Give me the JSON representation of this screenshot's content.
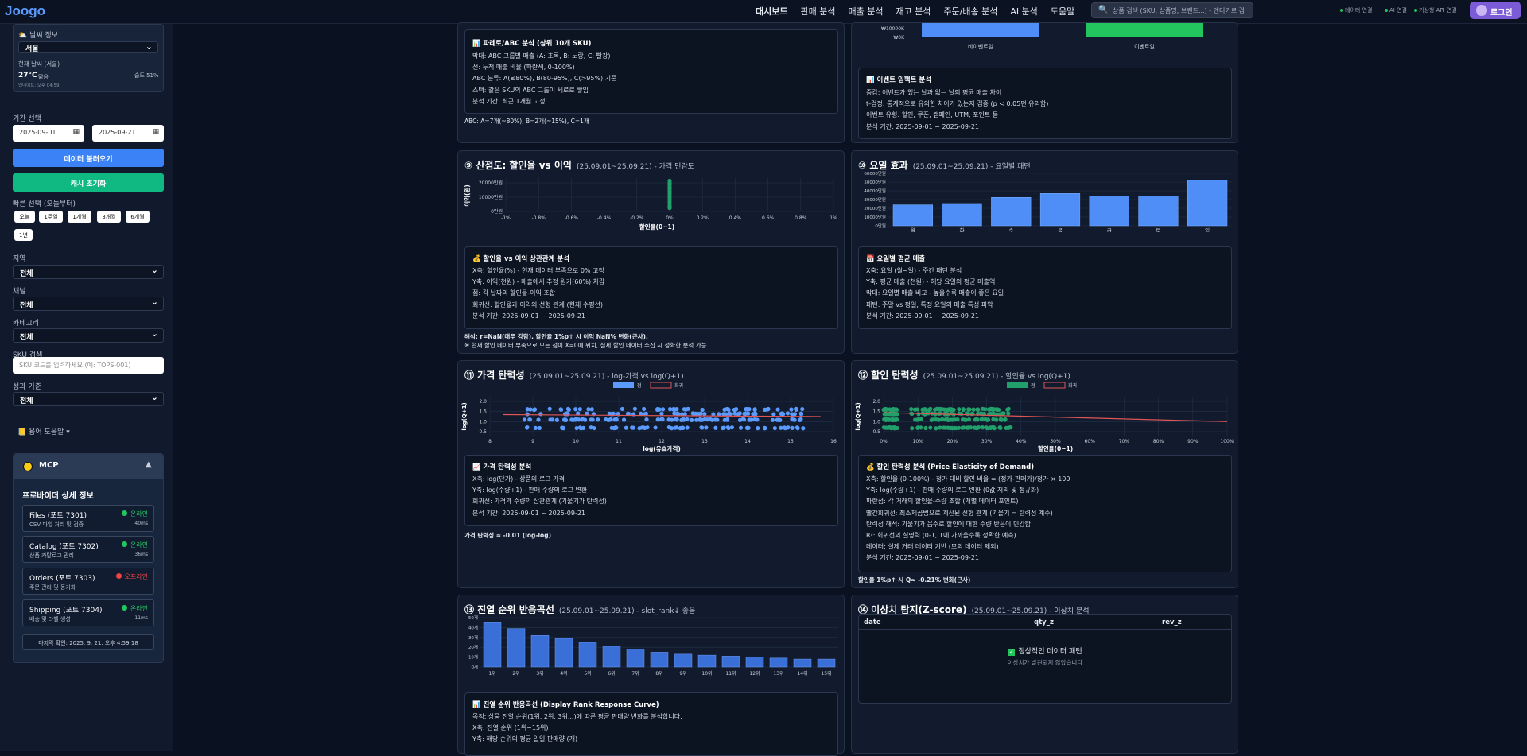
{
  "app": {
    "logo": "Joogo"
  },
  "nav": [
    "대시보드",
    "판매 분석",
    "매출 분석",
    "재고 분석",
    "주문/배송 분석",
    "AI 분석",
    "도움말"
  ],
  "search": {
    "placeholder": "상품 검색 (SKU, 상품명, 브랜드...) - 엔터키로 검"
  },
  "status": [
    "데이터 연결",
    "AI 연결",
    "기상청 API 연결"
  ],
  "login": "로그인",
  "sidebar": {
    "weather": {
      "title": "날씨 정보",
      "city": "서울",
      "current_label": "현재 날씨 (서울)",
      "temp": "27°C",
      "condition": "맑음",
      "humidity": "습도 51%",
      "updated": "업데이트: 오후 04:59"
    },
    "period_label": "기간 선택",
    "date_from": "2025-09-01",
    "date_to": "2025-09-21",
    "load_btn": "데이터 불러오기",
    "cache_btn": "캐시 초기화",
    "quick_label": "빠른 선택 (오늘부터)",
    "quick": [
      "오늘",
      "1주일",
      "1개월",
      "3개월",
      "6개월",
      "1년"
    ],
    "region_label": "지역",
    "region_value": "전체",
    "channel_label": "채널",
    "channel_value": "전체",
    "category_label": "카테고리",
    "category_value": "전체",
    "sku_label": "SKU 검색",
    "sku_placeholder": "SKU 코드를 입력하세요 (예: TOPS-001)",
    "perf_label": "성과 기준",
    "perf_value": "전체",
    "glossary": "용어 도움말",
    "mcp": {
      "title": "MCP",
      "subtitle": "프로바이더 상세 정보",
      "providers": [
        {
          "name": "Files (포트 7301)",
          "desc": "CSV 파일 처리 및 검증",
          "status": "온라인",
          "ms": "40ms",
          "color": "#22c55e"
        },
        {
          "name": "Catalog (포트 7302)",
          "desc": "상품 카탈로그 관리",
          "status": "온라인",
          "ms": "36ms",
          "color": "#22c55e"
        },
        {
          "name": "Orders (포트 7303)",
          "desc": "주문 관리 및 동기화",
          "status": "오프라인",
          "ms": "",
          "color": "#ef4444"
        },
        {
          "name": "Shipping (포트 7304)",
          "desc": "배송 및 라벨 생성",
          "status": "온라인",
          "ms": "11ms",
          "color": "#22c55e"
        }
      ],
      "last_check": "마지막 확인: 2025. 9. 21. 오후 4:59:18"
    }
  },
  "pareto_info": {
    "title": "파레토/ABC 분석 (상위 10개 SKU)",
    "items": [
      "막대: ABC 그룹별 매출 (A: 초록, B: 노랑, C: 빨강)",
      "선: 누적 매출 비율 (파란색, 0-100%)",
      "ABC 분류: A(≤80%), B(80-95%), C(>95%) 기준",
      "스택: 같은 SKU의 ABC 그룹이 세로로 쌓임",
      "분석 기간: 최근 1개월 고정"
    ],
    "summary": "ABC: A=7개(≈80%), B=2개(≈15%), C=1개"
  },
  "event_chart": {
    "y_label": "₩10000K",
    "y_zero": "₩0K",
    "categories": [
      "비이벤트일",
      "이벤트일"
    ]
  },
  "event_info": {
    "title": "이벤트 임팩트 분석",
    "items": [
      "증감: 이벤트가 있는 날과 없는 날의 평균 매출 차이",
      "t-검정: 통계적으로 유의한 차이가 있는지 검증 (p < 0.05면 유의함)",
      "이벤트 유형: 할인, 쿠폰, 캠페인, UTM, 포인트 등",
      "분석 기간: 2025-09-01 ~ 2025-09-21"
    ]
  },
  "scatter": {
    "title": "⑨ 산점도: 할인율 vs 이익",
    "subtitle": "(25.09.01~25.09.21) - 가격 민감도",
    "chart_data": {
      "type": "scatter",
      "ylabel": "이익(원)",
      "xlabel": "할인율(0~1)",
      "yticks": [
        "20000만원",
        "10000만원",
        "0만원"
      ],
      "xticks": [
        "-1%",
        "-0.8%",
        "-0.6%",
        "-0.4%",
        "-0.2%",
        "0%",
        "0.2%",
        "0.4%",
        "0.6%",
        "0.8%",
        "1%"
      ],
      "x": [
        0,
        0,
        0,
        0,
        0,
        0,
        0,
        0,
        0,
        0,
        0,
        0,
        0,
        0
      ],
      "y": [
        22000,
        20500,
        19000,
        17500,
        16000,
        14500,
        13000,
        11500,
        10000,
        8500,
        7000,
        5500,
        4000,
        2500
      ]
    },
    "info_title": "할인율 vs 이익 상관관계 분석",
    "items": [
      "X축: 할인율(%) - 현재 데이터 부족으로 0% 고정",
      "Y축: 이익(천원) - 매출에서 추정 원가(60%) 차감",
      "점: 각 날짜의 할인율-이익 조합",
      "회귀선: 할인율과 이익의 선형 관계 (현재 수평선)",
      "분석 기간: 2025-09-01 ~ 2025-09-21"
    ],
    "note1": "해석: r=NaN(매우 강함). 할인율 1%p↑ 시 이익 NaN% 변화(근사).",
    "note2": "※ 현재 할인 데이터 부족으로 모든 점이 X=0에 위치, 실제 할인 데이터 수집 시 정확한 분석 가능"
  },
  "weekday": {
    "title": "⑩ 요일 효과",
    "subtitle": "(25.09.01~25.09.21) - 요일별 패턴",
    "chart_data": {
      "type": "bar",
      "categories": [
        "월",
        "화",
        "수",
        "목",
        "금",
        "토",
        "일"
      ],
      "values": [
        24000000,
        25500000,
        32500000,
        37000000,
        34000000,
        34000000,
        52000000
      ],
      "yticks": [
        "60000만원",
        "50000만원",
        "40000만원",
        "30000만원",
        "20000만원",
        "10000만원",
        "0만원"
      ],
      "ylim": [
        0,
        60000000
      ]
    },
    "info_title": "요일별 평균 매출",
    "items": [
      "X축: 요일 (월~일) - 주간 패턴 분석",
      "Y축: 평균 매출 (천원) - 해당 요일의 평균 매출액",
      "막대: 요일별 매출 비교 - 높을수록 매출이 좋은 요일",
      "패턴: 주말 vs 평일, 특정 요일의 매출 특성 파악",
      "분석 기간: 2025-09-01 ~ 2025-09-21"
    ]
  },
  "price_el": {
    "title": "⑪ 가격 탄력성",
    "subtitle": "(25.09.01~25.09.21) - log-가격 vs log(Q+1)",
    "chart_data": {
      "type": "scatter",
      "legend": [
        "점",
        "회귀"
      ],
      "ylabel": "log(Q+1)",
      "xlabel": "log(유효가격)",
      "xticks": [
        "8",
        "9",
        "10",
        "11",
        "12",
        "13",
        "14",
        "15",
        "16"
      ],
      "yticks": [
        "2.0",
        "1.5",
        "1.0",
        "0.5"
      ],
      "xlim": [
        8,
        16
      ],
      "ylim": [
        0.3,
        2.2
      ],
      "reg": [
        [
          8.3,
          1.35
        ],
        [
          15.7,
          1.25
        ]
      ]
    },
    "info_title": "가격 탄력성 분석",
    "items": [
      "X축: log(단가) - 상품의 로그 가격",
      "Y축: log(수량+1) - 판매 수량의 로그 변환",
      "회귀선: 가격과 수량의 상관관계 (기울기가 탄력성)",
      "분석 기간: 2025-09-01 ~ 2025-09-21"
    ],
    "note": "가격 탄력성 ≈ -0.01 (log-log)"
  },
  "disc_el": {
    "title": "⑫ 할인 탄력성",
    "subtitle": "(25.09.01~25.09.21) - 할인율 vs log(Q+1)",
    "chart_data": {
      "type": "scatter",
      "legend": [
        "점",
        "회귀"
      ],
      "ylabel": "log(Q+1)",
      "xlabel": "할인율(0~1)",
      "xticks": [
        "0%",
        "10%",
        "20%",
        "30%",
        "40%",
        "50%",
        "60%",
        "70%",
        "80%",
        "90%",
        "100%"
      ],
      "yticks": [
        "2.0",
        "1.5",
        "1.0",
        "0.5"
      ],
      "xlim": [
        0,
        100
      ],
      "ylim": [
        0.3,
        2.2
      ],
      "reg": [
        [
          0,
          1.45
        ],
        [
          100,
          1.0
        ]
      ]
    },
    "info_title": "할인 탄력성 분석 (Price Elasticity of Demand)",
    "items": [
      "X축: 할인율 (0-100%) - 정가 대비 할인 비율 = (정가-판매가)/정가 × 100",
      "Y축: log(수량+1) - 판매 수량의 로그 변환 (0값 처리 및 정규화)",
      "파란점: 각 거래의 할인율-수량 조합 (개별 데이터 포인트)",
      "빨간회귀선: 최소제곱법으로 계산된 선형 관계 (기울기 = 탄력성 계수)",
      "탄력성 해석: 기울기가 음수로 할인에 대한 수량 반응이 민감함",
      "R²: 회귀선의 설명력 (0-1, 1에 가까울수록 정확한 예측)",
      "데이터: 실제 거래 데이터 기반 (모의 데이터 제외)",
      "분석 기간: 2025-09-01 ~ 2025-09-21"
    ],
    "note": "할인율 1%p↑ 시 Q≈ -0.21% 변화(근사)"
  },
  "rank": {
    "title": "⑬ 진열 순위 반응곡선",
    "subtitle": "(25.09.01~25.09.21) - slot_rank↓ 좋음",
    "chart_data": {
      "type": "bar",
      "categories": [
        "1위",
        "2위",
        "3위",
        "4위",
        "5위",
        "6위",
        "7위",
        "8위",
        "9위",
        "10위",
        "11위",
        "12위",
        "13위",
        "14위",
        "15위"
      ],
      "values": [
        45,
        39,
        32,
        29,
        25,
        21,
        18,
        15,
        13,
        12,
        11,
        10,
        9,
        8,
        8
      ],
      "yticks": [
        "50개",
        "40개",
        "30개",
        "20개",
        "10개",
        "0개"
      ],
      "ylim": [
        0,
        50
      ]
    },
    "info_title": "진열 순위 반응곡선 (Display Rank Response Curve)",
    "items": [
      "목적: 상품 진열 순위(1위, 2위, 3위...)에 따른 평균 판매량 변화를 분석합니다.",
      "X축: 진열 순위 (1위~15위)",
      "Y축: 해당 순위의 평균 일일 판매량 (개)"
    ]
  },
  "anomaly": {
    "title": "⑭ 이상치 탐지(Z-score)",
    "subtitle": "(25.09.01~25.09.21) - 이상치 분석",
    "columns": [
      "date",
      "qty_z",
      "rev_z"
    ],
    "ok_text": "정상적인 데이터 패턴",
    "ok_sub": "이상치가 발견되지 않았습니다"
  },
  "colors": {
    "accent": "#4f8ef7",
    "green": "#22c55e",
    "bar_blue": "#4f8ef7",
    "rank_blue": "#3b6fd8"
  }
}
